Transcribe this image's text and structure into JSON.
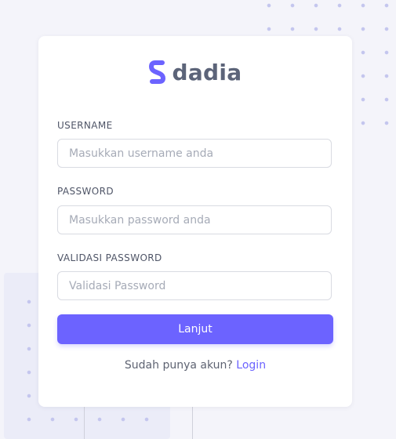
{
  "brand": {
    "name": "dadia"
  },
  "form": {
    "username": {
      "label": "USERNAME",
      "placeholder": "Masukkan username anda"
    },
    "password": {
      "label": "PASSWORD",
      "placeholder": "Masukkan password anda"
    },
    "confirm": {
      "label": "VALIDASI PASSWORD",
      "placeholder": "Validasi Password"
    },
    "submit_label": "Lanjut"
  },
  "footer": {
    "prompt": "Sudah punya akun?",
    "link_label": "Login"
  },
  "colors": {
    "accent": "#6c63ff",
    "background": "#f4f4fa",
    "text": "#5c6479"
  }
}
